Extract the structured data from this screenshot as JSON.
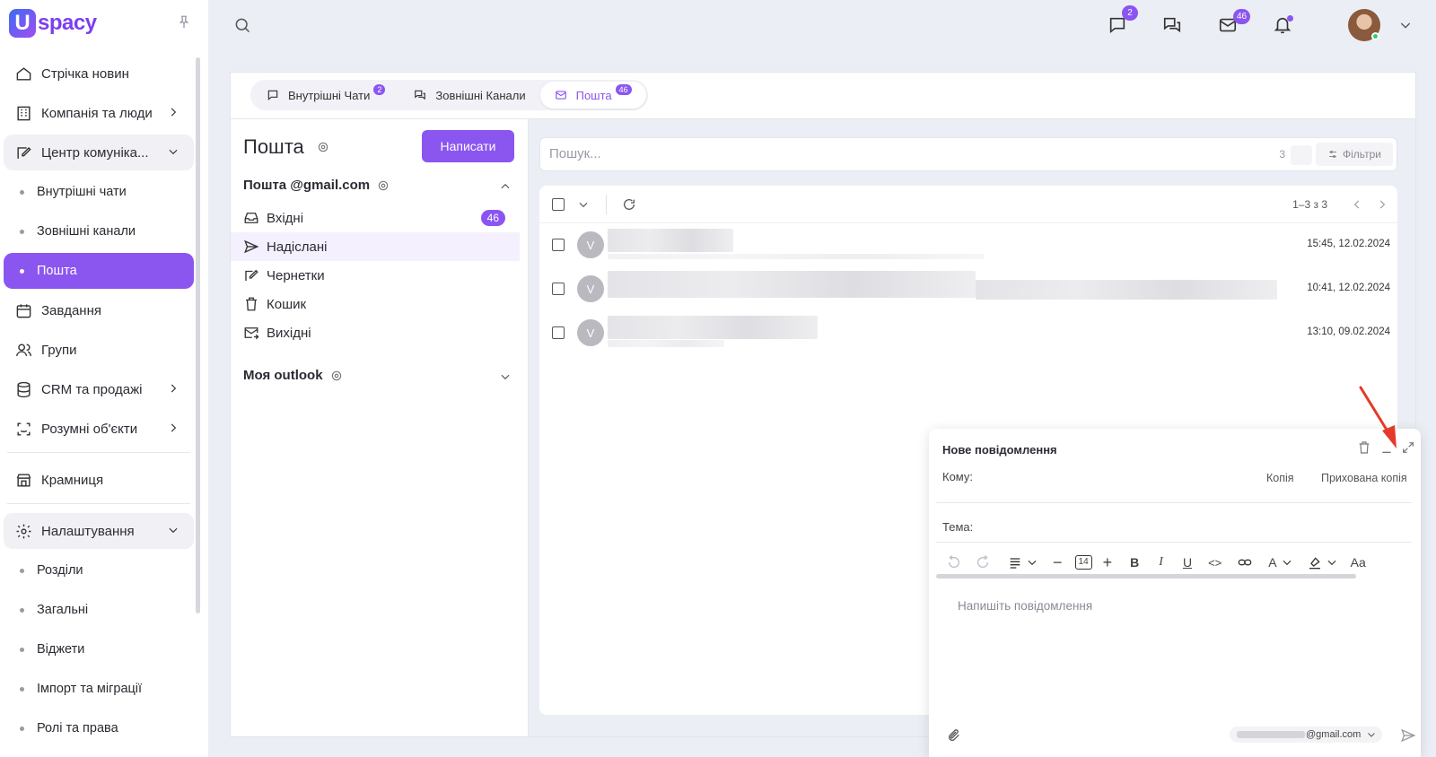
{
  "app": {
    "logo_mark": "U",
    "logo_word": "spacy",
    "brand_color": "#8b55f0"
  },
  "sidebar": {
    "items": [
      {
        "label": "Стрічка новин",
        "icon": "home-icon"
      },
      {
        "label": "Компанія та люди",
        "icon": "building-icon"
      },
      {
        "label": "Центр комуніка...",
        "icon": "chat-edit-icon"
      },
      {
        "label": "Внутрішні чати"
      },
      {
        "label": "Зовнішні канали"
      },
      {
        "label": "Пошта"
      },
      {
        "label": "Завдання",
        "icon": "calendar-icon"
      },
      {
        "label": "Групи",
        "icon": "users-icon"
      },
      {
        "label": "CRM та продажі",
        "icon": "database-icon"
      },
      {
        "label": "Розумні об'єкти",
        "icon": "scan-icon"
      },
      {
        "label": "Крамниця",
        "icon": "store-icon"
      },
      {
        "label": "Налаштування",
        "icon": "gear-icon"
      },
      {
        "label": "Розділи"
      },
      {
        "label": "Загальні"
      },
      {
        "label": "Віджети"
      },
      {
        "label": "Імпорт та міграції"
      },
      {
        "label": "Ролі та права"
      }
    ]
  },
  "topbar": {
    "chat_badge": "2",
    "mail_badge": "46"
  },
  "tabs": [
    {
      "label": "Внутрішні Чати",
      "badge": "2"
    },
    {
      "label": "Зовнішні Канали"
    },
    {
      "label": "Пошта",
      "badge": "46"
    }
  ],
  "mail": {
    "title": "Пошта",
    "write_button": "Написати",
    "account1": "Пошта @gmail.com",
    "account2": "Моя outlook",
    "folders": [
      {
        "label": "Вхідні",
        "badge": "46"
      },
      {
        "label": "Надіслані"
      },
      {
        "label": "Чернетки"
      },
      {
        "label": "Кошик"
      },
      {
        "label": "Вихідні"
      }
    ],
    "search_placeholder": "Пошук...",
    "search_count": "3",
    "filters_label": "Фільтри",
    "pager": "1–3 з 3",
    "rows": [
      {
        "avatar": "V",
        "time": "15:45, 12.02.2024"
      },
      {
        "avatar": "V",
        "time": "10:41, 12.02.2024"
      },
      {
        "avatar": "V",
        "time": "13:10, 09.02.2024"
      }
    ]
  },
  "compose": {
    "title": "Нове повідомлення",
    "to_label": "Кому:",
    "cc_label": "Копія",
    "bcc_label": "Прихована копія",
    "subject_label": "Тема:",
    "font_size": "14",
    "bold": "B",
    "italic": "I",
    "underline": "U",
    "code": "<>",
    "text_color": "A",
    "font_style": "Aa",
    "body_placeholder": "Напишіть повідомлення",
    "from_suffix": "@gmail.com"
  }
}
